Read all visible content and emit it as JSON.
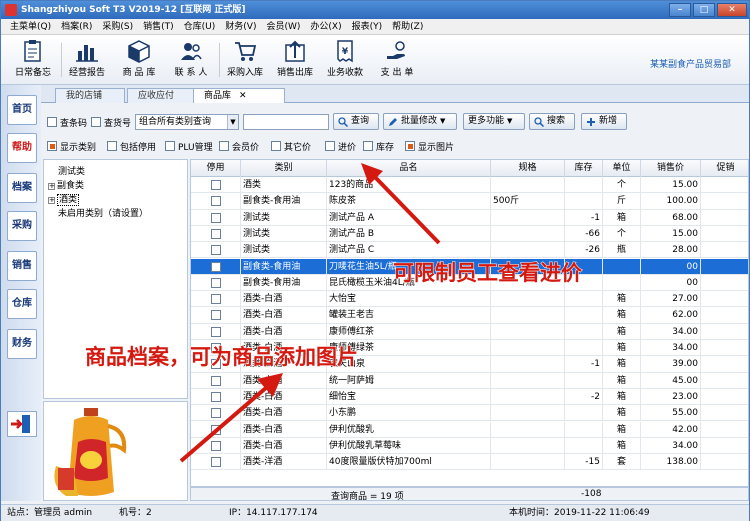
{
  "title": "Shangzhiyou Soft T3 V2019-12 [互联网 正式版]",
  "window_buttons": {
    "minimize": "–",
    "maximize": "□",
    "close": "✕"
  },
  "menu": [
    "主菜单(Q)",
    "档案(R)",
    "采购(S)",
    "销售(T)",
    "仓库(U)",
    "财务(V)",
    "会员(W)",
    "办公(X)",
    "报表(Y)",
    "帮助(Z)"
  ],
  "toolbar": [
    {
      "label": "日常备忘",
      "icon": "memo-icon"
    },
    {
      "label": "经营报告",
      "icon": "bar-chart-icon"
    },
    {
      "label": "商 品 库",
      "icon": "box-icon"
    },
    {
      "label": "联 系 人",
      "icon": "contacts-icon"
    },
    {
      "label": "采购入库",
      "icon": "cart-icon"
    },
    {
      "label": "销售出库",
      "icon": "upload-icon"
    },
    {
      "label": "业务收款",
      "icon": "receipt-yen-icon"
    },
    {
      "label": "支 出 单",
      "icon": "payment-hand-icon"
    }
  ],
  "company": "某某副食产品贸易部",
  "left_nav": [
    {
      "label": "首页",
      "active": false
    },
    {
      "label": "帮助",
      "active": true
    },
    {
      "label": "档案",
      "active": false
    },
    {
      "label": "采购",
      "active": false
    },
    {
      "label": "销售",
      "active": false
    },
    {
      "label": "仓库",
      "active": false
    },
    {
      "label": "财务",
      "active": false
    }
  ],
  "tabs": [
    {
      "label": "我的店铺",
      "active": false
    },
    {
      "label": "应收应付",
      "active": false
    },
    {
      "label": "商品库",
      "active": true,
      "close": "✕"
    }
  ],
  "filters": {
    "check_barcode": {
      "label": "查条码",
      "checked": false
    },
    "check_item_no": {
      "label": "查货号",
      "checked": false
    },
    "category_query": "组合所有类别查询",
    "search_value": "",
    "query_button": "查询",
    "batch_edit_button": "批量修改",
    "more_button": "更多功能",
    "search_button": "搜索",
    "new_button": "新增"
  },
  "options": [
    {
      "label": "显示类别",
      "checked": true
    },
    {
      "label": "包括停用",
      "checked": false
    },
    {
      "label": "PLU管理",
      "checked": false
    },
    {
      "label": "会员价",
      "checked": false
    },
    {
      "label": "其它价",
      "checked": false
    },
    {
      "label": "进价",
      "checked": false
    },
    {
      "label": "库存",
      "checked": false
    },
    {
      "label": "显示图片",
      "checked": true
    }
  ],
  "tree": [
    {
      "label": "测试类",
      "toggle": ""
    },
    {
      "label": "副食类",
      "toggle": "+"
    },
    {
      "label": "酒类",
      "toggle": "+",
      "selected": true
    },
    {
      "label": "未启用类别（请设置）",
      "toggle": ""
    }
  ],
  "columns": [
    "停用",
    "类别",
    "品名",
    "规格",
    "库存",
    "单位",
    "销售价",
    "促销"
  ],
  "rows": [
    {
      "cat": "酒类",
      "name": "123的商品",
      "spec": "",
      "stock": "",
      "unit": "个",
      "price": "15.00"
    },
    {
      "cat": "副食类-食用油",
      "name": "陈皮茶",
      "spec": "500斤",
      "stock": "",
      "unit": "斤",
      "price": "100.00"
    },
    {
      "cat": "测试类",
      "name": "测试产品 A",
      "spec": "",
      "stock": "-1",
      "unit": "箱",
      "price": "68.00"
    },
    {
      "cat": "测试类",
      "name": "测试产品 B",
      "spec": "",
      "stock": "-66",
      "unit": "个",
      "price": "15.00"
    },
    {
      "cat": "测试类",
      "name": "测试产品 C",
      "spec": "",
      "stock": "-26",
      "unit": "瓶",
      "price": "28.00"
    },
    {
      "cat": "副食类-食用油",
      "name": "刀唛花生油5L/瓶",
      "spec": "",
      "stock": "",
      "unit": "",
      "price": "00",
      "selected": true
    },
    {
      "cat": "副食类-食用油",
      "name": "昆氏橄榄玉米油4L/瓶",
      "spec": "",
      "stock": "",
      "unit": "",
      "price": "00"
    },
    {
      "cat": "酒类-白酒",
      "name": "大怡宝",
      "spec": "",
      "stock": "",
      "unit": "箱",
      "price": "27.00"
    },
    {
      "cat": "酒类-白酒",
      "name": "罐装王老吉",
      "spec": "",
      "stock": "",
      "unit": "箱",
      "price": "62.00"
    },
    {
      "cat": "酒类-白酒",
      "name": "康师傅红茶",
      "spec": "",
      "stock": "",
      "unit": "箱",
      "price": "34.00"
    },
    {
      "cat": "酒类-白酒",
      "name": "康师傅绿茶",
      "spec": "",
      "stock": "",
      "unit": "箱",
      "price": "34.00"
    },
    {
      "cat": "酒类-白酒",
      "name": "农夫山泉",
      "spec": "",
      "stock": "-1",
      "unit": "箱",
      "price": "39.00"
    },
    {
      "cat": "酒类-白酒",
      "name": "统一阿萨姆",
      "spec": "",
      "stock": "",
      "unit": "箱",
      "price": "45.00"
    },
    {
      "cat": "酒类-白酒",
      "name": "细怡宝",
      "spec": "",
      "stock": "-2",
      "unit": "箱",
      "price": "23.00"
    },
    {
      "cat": "酒类-白酒",
      "name": "小东鹏",
      "spec": "",
      "stock": "",
      "unit": "箱",
      "price": "55.00"
    },
    {
      "cat": "酒类-白酒",
      "name": "伊利优酸乳",
      "spec": "",
      "stock": "",
      "unit": "箱",
      "price": "42.00"
    },
    {
      "cat": "酒类-白酒",
      "name": "伊利优酸乳草莓味",
      "spec": "",
      "stock": "",
      "unit": "箱",
      "price": "34.00"
    },
    {
      "cat": "酒类-洋酒",
      "name": "40度限量版伏特加700ml",
      "spec": "",
      "stock": "-15",
      "unit": "套",
      "price": "138.00"
    }
  ],
  "footer": {
    "summary": "查询商品 = 19 项",
    "stock_total": "-108"
  },
  "status": {
    "station": "站点：管理员 admin",
    "machine": "机号：2",
    "ip": "IP：14.117.177.174",
    "time": "本机时间：2019-11-22 11:06:49"
  },
  "annotations": {
    "top": "可限制员工查看进价",
    "bottom": "商品档案，可为商品添加图片"
  },
  "colors": {
    "accent": "#1c6ed6",
    "annotation": "#d41a10",
    "title": "#2f6bbd"
  }
}
